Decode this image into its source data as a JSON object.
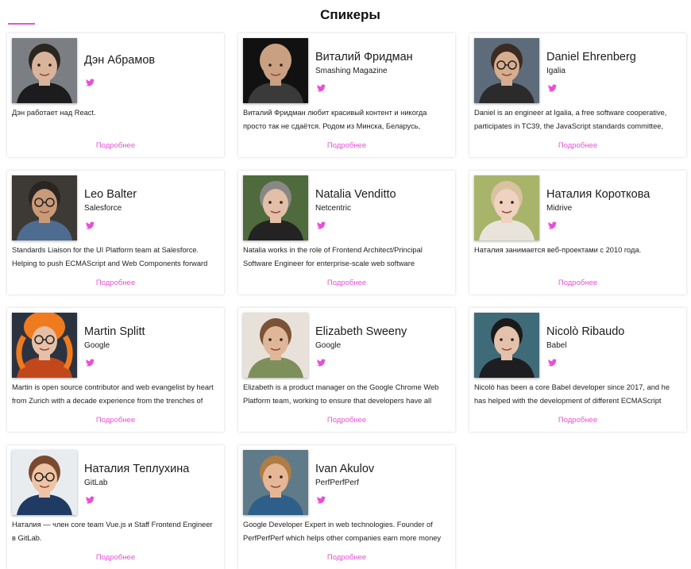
{
  "page": {
    "title": "Спикеры",
    "accent_color": "#e84fd5"
  },
  "speakers": [
    {
      "name": "Дэн Абрамов",
      "company": "",
      "bio": "Дэн работает над React.",
      "more_label": "Подробнее",
      "twitter_icon": "twitter-icon",
      "photo": {
        "bg": "#7b7f83",
        "skin": "#d9b39a",
        "hair": "#2c2621",
        "shirt": "#1c1c1e",
        "glasses": false,
        "hat": false
      }
    },
    {
      "name": "Виталий Фридман",
      "company": "Smashing Magazine",
      "bio": "Виталий Фридман любит красивый контент и никогда просто так не сдаётся. Родом из Минска, Беларусь, Виталий",
      "more_label": "Подробнее",
      "twitter_icon": "twitter-icon",
      "photo": {
        "bg": "#111111",
        "skin": "#c9a081",
        "hair": "#c9a081",
        "shirt": "#3a3a3a",
        "glasses": false,
        "hat": false
      }
    },
    {
      "name": "Daniel Ehrenberg",
      "company": "Igalia",
      "bio": "Daniel is an engineer at Igalia, a free software cooperative, participates in TC39, the JavaScript standards committee,",
      "more_label": "Подробнее",
      "twitter_icon": "twitter-icon",
      "photo": {
        "bg": "#5d6b7a",
        "skin": "#d7ad8f",
        "hair": "#3b2b22",
        "shirt": "#2b2b2b",
        "glasses": true,
        "hat": false
      }
    },
    {
      "name": "Leo Balter",
      "company": "Salesforce",
      "bio": "Standards Liaison for the UI Platform team at Salesforce. Helping to push ECMAScript and Web Components forward",
      "more_label": "Подробнее",
      "twitter_icon": "twitter-icon",
      "photo": {
        "bg": "#3d3a36",
        "skin": "#c99a78",
        "hair": "#2a2522",
        "shirt": "#4d6c8f",
        "glasses": true,
        "hat": false
      }
    },
    {
      "name": "Natalia Venditto",
      "company": "Netcentric",
      "bio": "Natalia works in the role of Frontend Architect/Principal Software Engineer for enterprise-scale web software",
      "more_label": "Подробнее",
      "twitter_icon": "twitter-icon",
      "photo": {
        "bg": "#4f6a3c",
        "skin": "#e2bfa6",
        "hair": "#8a8886",
        "shirt": "#232323",
        "glasses": false,
        "hat": false
      }
    },
    {
      "name": "Наталия Короткова",
      "company": "Midrive",
      "bio": "Наталия занимается веб-проектами с 2010 года.",
      "more_label": "Подробнее",
      "twitter_icon": "twitter-icon",
      "photo": {
        "bg": "#a7b46a",
        "skin": "#efd2bf",
        "hair": "#d9c2a0",
        "shirt": "#e8e4dc",
        "glasses": false,
        "hat": false
      }
    },
    {
      "name": "Martin Splitt",
      "company": "Google",
      "bio": "Martin is open source contributor and web evangelist by heart from Zurich with a decade experience from the trenches of",
      "more_label": "Подробнее",
      "twitter_icon": "twitter-icon",
      "photo": {
        "bg": "#2b3340",
        "skin": "#e5bfa6",
        "hair": "#f07a1e",
        "shirt": "#c2481c",
        "glasses": true,
        "hat": true
      }
    },
    {
      "name": "Elizabeth Sweeny",
      "company": "Google",
      "bio": "Elizabeth is a product manager on the Google Chrome Web Platform team, working to ensure that developers have all",
      "more_label": "Подробнее",
      "twitter_icon": "twitter-icon",
      "photo": {
        "bg": "#e7e1da",
        "skin": "#e0b698",
        "hair": "#7a5336",
        "shirt": "#7d8f5a",
        "glasses": false,
        "hat": false
      }
    },
    {
      "name": "Nicolò Ribaudo",
      "company": "Babel",
      "bio": "Nicolò has been a core Babel developer since 2017, and he has helped with the development of different ECMAScript",
      "more_label": "Подробнее",
      "twitter_icon": "twitter-icon",
      "photo": {
        "bg": "#3f6b78",
        "skin": "#e4c1aa",
        "hair": "#1a1a1a",
        "shirt": "#1e1e22",
        "glasses": false,
        "hat": false
      }
    },
    {
      "name": "Наталия Теплухина",
      "company": "GitLab",
      "bio": "Наталия — член core team Vue.js и Staff Frontend Engineer в GitLab.",
      "more_label": "Подробнее",
      "twitter_icon": "twitter-icon",
      "photo": {
        "bg": "#e9ecef",
        "skin": "#efc3a6",
        "hair": "#7a4a2e",
        "shirt": "#1f3b63",
        "glasses": true,
        "hat": false
      }
    },
    {
      "name": "Ivan Akulov",
      "company": "PerfPerfPerf",
      "bio": "Google Developer Expert in web technologies. Founder of PerfPerfPerf which helps other companies earn more money",
      "more_label": "Подробнее",
      "twitter_icon": "twitter-icon",
      "photo": {
        "bg": "#5f7b8a",
        "skin": "#e6b796",
        "hair": "#b07c45",
        "shirt": "#2e5f8a",
        "glasses": false,
        "hat": false
      }
    }
  ]
}
